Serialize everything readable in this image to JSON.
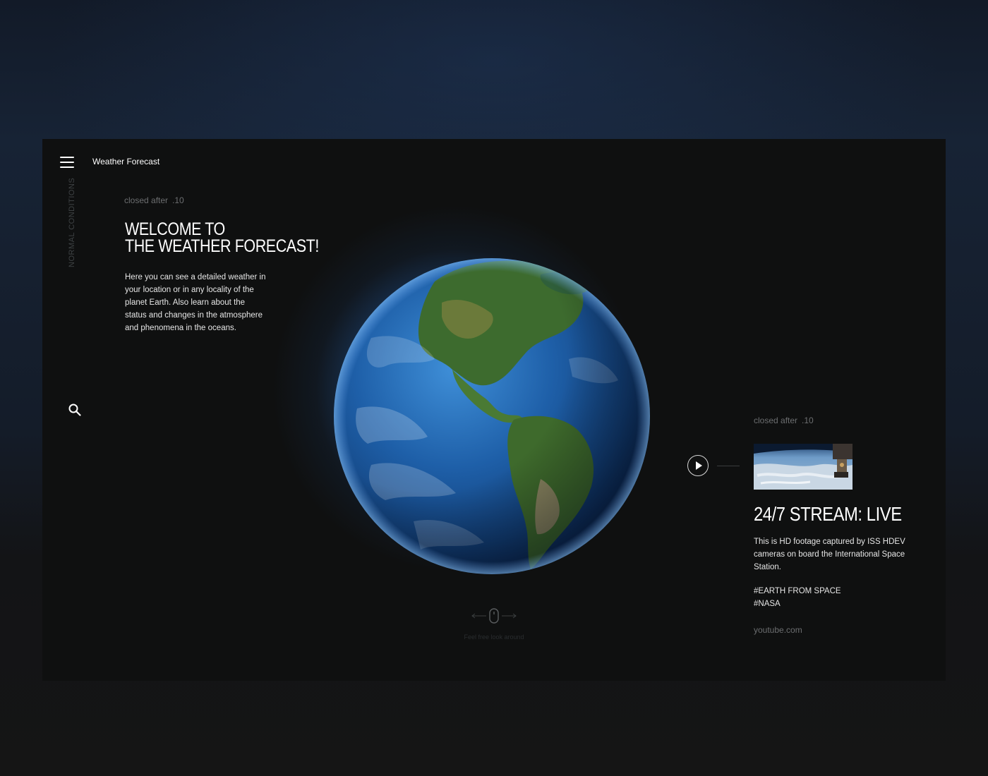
{
  "header": {
    "title": "Weather Forecast",
    "menu_icon": "hamburger-menu-icon"
  },
  "sidebar": {
    "status_label": "NORMAL CONDITIONS",
    "search_icon": "search-icon"
  },
  "intro": {
    "closed_label": "closed after",
    "closed_value": ".10",
    "heading_line1": "WELCOME TO",
    "heading_line2": "THE WEATHER FORECAST!",
    "description": "Here you can see a detailed weather in your location or in any locality of the planet Earth. Also learn about the status and changes in the atmosphere and phenomena in the oceans."
  },
  "globe": {
    "image": "earth-globe-americas",
    "accent_color": "#2f7fd6"
  },
  "scroll_hint": {
    "icon": "mouse-icon",
    "text": "Feel free look around"
  },
  "stream": {
    "closed_label": "closed after",
    "closed_value": ".10",
    "play_icon": "play-icon",
    "thumbnail": "iss-earth-from-space-thumbnail",
    "title": "24/7 STREAM: LIVE",
    "description": "This is HD footage captured by ISS HDEV cameras on board the International Space Station.",
    "tags": [
      "#EARTH FROM SPACE",
      "#NASA"
    ],
    "source": "youtube.com"
  },
  "colors": {
    "panel": "#0f1010",
    "muted_text": "#6c6e70",
    "text": "#ffffff"
  }
}
